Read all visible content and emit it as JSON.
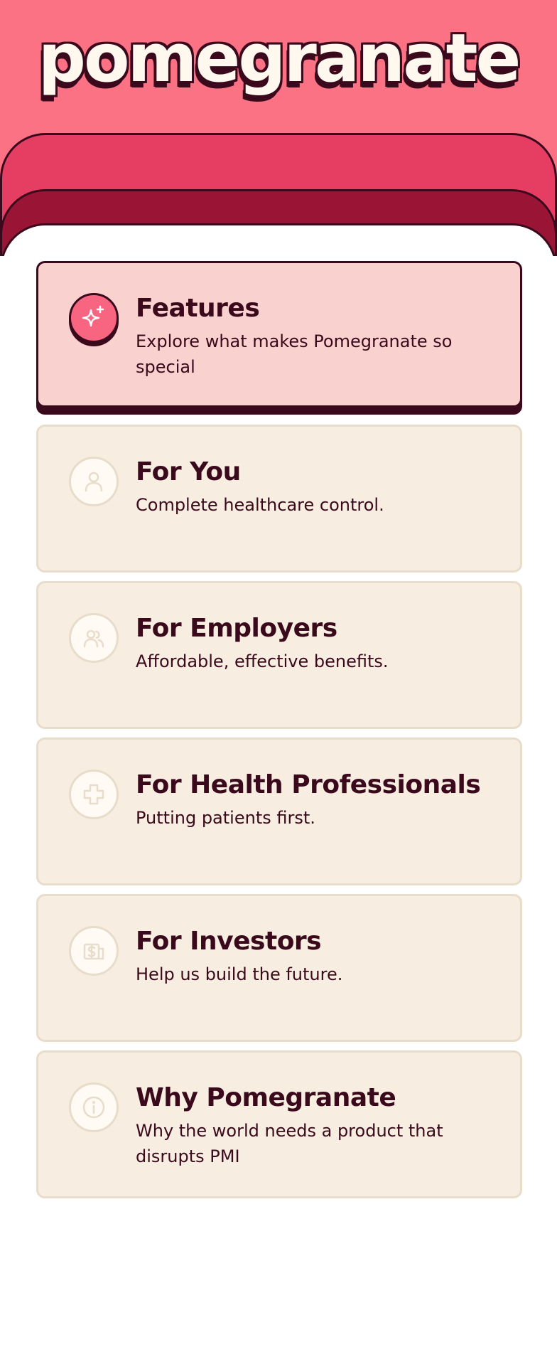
{
  "brand": {
    "logo_text": "pomegranate"
  },
  "menu": {
    "items": [
      {
        "title": "Features",
        "description": "Explore what makes Pomegranate so special",
        "icon": "sparkle-icon",
        "active": true
      },
      {
        "title": "For You",
        "description": "Complete healthcare control.",
        "icon": "person-icon",
        "active": false
      },
      {
        "title": "For Employers",
        "description": "Affordable, effective benefits.",
        "icon": "people-icon",
        "active": false
      },
      {
        "title": "For Health Professionals",
        "description": "Putting patients first.",
        "icon": "medical-cross-icon",
        "active": false
      },
      {
        "title": "For Investors",
        "description": "Help us build the future.",
        "icon": "money-icon",
        "active": false
      },
      {
        "title": "Why Pomegranate",
        "description": "Why the world needs a product that disrupts PMI",
        "icon": "info-icon",
        "active": false
      }
    ]
  },
  "colors": {
    "header_pink": "#fb7285",
    "band_red": "#e63e62",
    "band_maroon": "#9a1535",
    "ink": "#3a0a1c",
    "card_cream": "#f7ede1",
    "card_active": "#f9d1ce"
  }
}
